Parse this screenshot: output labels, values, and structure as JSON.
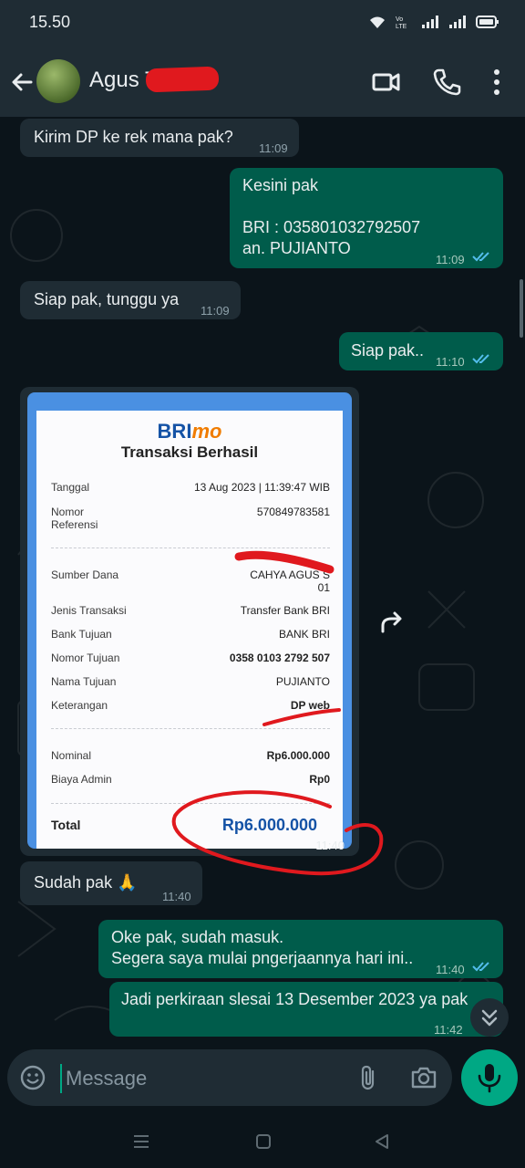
{
  "status_bar": {
    "time": "15.50"
  },
  "header": {
    "contact_name": "Agus T"
  },
  "messages": [
    {
      "dir": "in",
      "text": "Kirim DP ke rek mana pak?",
      "time": "11:09"
    },
    {
      "dir": "out",
      "text": "Kesini pak\n\nBRI : 035801032792507\nan. PUJIANTO",
      "time": "11:09"
    },
    {
      "dir": "in",
      "text": "Siap pak, tunggu ya",
      "time": "11:09"
    },
    {
      "dir": "out",
      "text": "Siap pak..",
      "time": "11:10"
    },
    {
      "dir": "in",
      "text": "Sudah pak 🙏",
      "time": "11:40"
    },
    {
      "dir": "out",
      "text": "Oke pak, sudah masuk.\nSegera saya mulai pngerjaannya hari ini..",
      "time": "11:40"
    },
    {
      "dir": "out",
      "text": "Jadi perkiraan slesai 13 Desember 2023 ya pak",
      "time": "11:42"
    }
  ],
  "receipt": {
    "brand_bri": "BRI",
    "brand_mo": "mo",
    "title": "Transaksi Berhasil",
    "time": "11:40",
    "rows": [
      {
        "label": "Tanggal",
        "value": "13 Aug 2023 | 11:39:47 WIB"
      },
      {
        "label": "Nomor\nReferensi",
        "value": "570849783581"
      },
      {
        "label": "Sumber Dana",
        "value": "CAHYA AGUS S\n01"
      },
      {
        "label": "Jenis Transaksi",
        "value": "Transfer Bank BRI"
      },
      {
        "label": "Bank Tujuan",
        "value": "BANK BRI"
      },
      {
        "label": "Nomor Tujuan",
        "value": "0358 0103 2792 507"
      },
      {
        "label": "Nama Tujuan",
        "value": "PUJIANTO"
      },
      {
        "label": "Keterangan",
        "value": "DP web"
      },
      {
        "label": "Nominal",
        "value": "Rp6.000.000"
      },
      {
        "label": "Biaya Admin",
        "value": "Rp0"
      }
    ],
    "total_label": "Total",
    "total_value": "Rp6.000.000"
  },
  "input": {
    "placeholder": "Message"
  },
  "colors": {
    "incoming": "#1f2c34",
    "outgoing": "#005c4b",
    "accent": "#00a884",
    "read_ticks": "#53bdeb"
  },
  "icons": [
    "back-arrow-icon",
    "video-call-icon",
    "phone-icon",
    "more-vert-icon",
    "forward-icon",
    "chevron-down-icon",
    "emoji-icon",
    "attach-icon",
    "camera-icon",
    "mic-icon"
  ]
}
